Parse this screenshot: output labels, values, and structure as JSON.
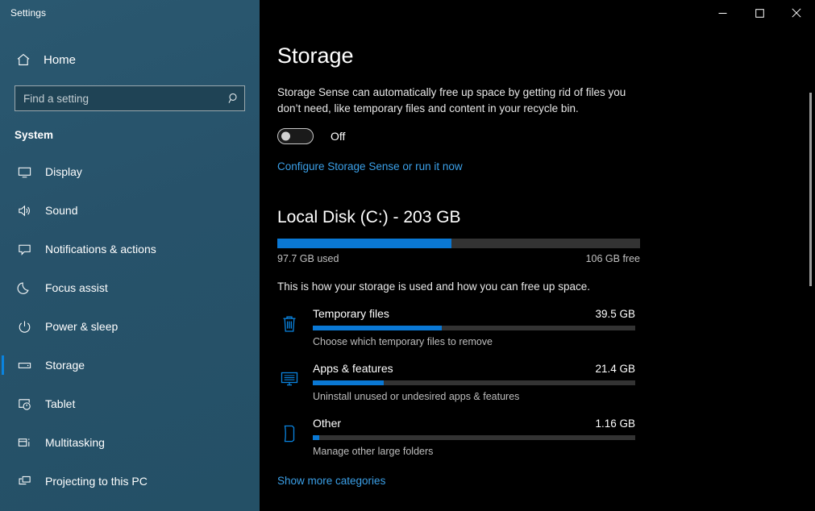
{
  "window": {
    "app_title": "Settings",
    "controls": [
      {
        "name": "minimize",
        "glyph": "—"
      },
      {
        "name": "maximize",
        "glyph": "□"
      },
      {
        "name": "close",
        "glyph": "✕"
      }
    ]
  },
  "sidebar": {
    "home_label": "Home",
    "search": {
      "placeholder": "Find a setting",
      "value": "",
      "icon": "search-icon"
    },
    "section_title": "System",
    "items": [
      {
        "label": "Display",
        "icon": "monitor-icon",
        "selected": false
      },
      {
        "label": "Sound",
        "icon": "speaker-icon",
        "selected": false
      },
      {
        "label": "Notifications & actions",
        "icon": "chat-bubble-icon",
        "selected": false
      },
      {
        "label": "Focus assist",
        "icon": "moon-icon",
        "selected": false
      },
      {
        "label": "Power & sleep",
        "icon": "power-icon",
        "selected": false
      },
      {
        "label": "Storage",
        "icon": "drive-icon",
        "selected": true
      },
      {
        "label": "Tablet",
        "icon": "tablet-hand-icon",
        "selected": false
      },
      {
        "label": "Multitasking",
        "icon": "multitasking-icon",
        "selected": false
      },
      {
        "label": "Projecting to this PC",
        "icon": "projecting-icon",
        "selected": false
      }
    ]
  },
  "main": {
    "page_title": "Storage",
    "storage_sense": {
      "description": "Storage Sense can automatically free up space by getting rid of files you don’t need, like temporary files and content in your recycle bin.",
      "toggle_state": "Off",
      "toggle_on": false,
      "configure_link": "Configure Storage Sense or run it now"
    },
    "disk": {
      "title": "Local Disk (C:) - 203 GB",
      "used_label": "97.7 GB used",
      "free_label": "106 GB free",
      "used_percent": 48,
      "description": "This is how your storage is used and how you can free up space."
    },
    "categories": [
      {
        "name": "Temporary files",
        "size": "39.5 GB",
        "percent": 40,
        "subtitle": "Choose which temporary files to remove",
        "icon": "trash-icon"
      },
      {
        "name": "Apps & features",
        "size": "21.4 GB",
        "percent": 22,
        "subtitle": "Uninstall unused or undesired apps & features",
        "icon": "apps-monitor-icon"
      },
      {
        "name": "Other",
        "size": "1.16 GB",
        "percent": 2,
        "subtitle": "Manage other large folders",
        "icon": "folder-page-icon"
      }
    ],
    "show_more_label": "Show more categories"
  },
  "colors": {
    "accent_blue": "#0a78d4",
    "link_blue": "#3ba0e8",
    "sidebar_bg": "#27536a",
    "main_bg": "#000000",
    "track_grey": "#333333"
  }
}
